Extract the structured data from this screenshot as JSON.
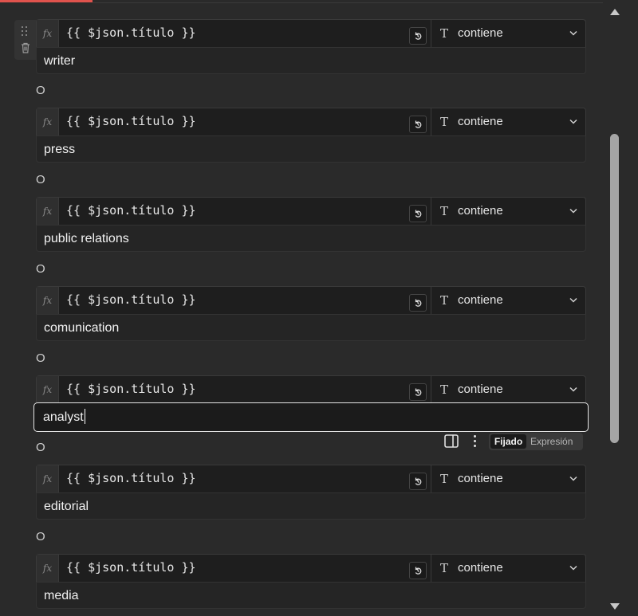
{
  "conditions": [
    {
      "expression": "{{ $json.título }}",
      "operator": "contiene",
      "value": "writer"
    },
    {
      "expression": "{{ $json.título }}",
      "operator": "contiene",
      "value": "press"
    },
    {
      "expression": "{{ $json.título }}",
      "operator": "contiene",
      "value": "public relations"
    },
    {
      "expression": "{{ $json.título }}",
      "operator": "contiene",
      "value": "comunication"
    },
    {
      "expression": "{{ $json.título }}",
      "operator": "contiene",
      "value": "analyst"
    },
    {
      "expression": "{{ $json.título }}",
      "operator": "contiene",
      "value": "editorial"
    },
    {
      "expression": "{{ $json.título }}",
      "operator": "contiene",
      "value": "media"
    }
  ],
  "combinator": "O",
  "fx_label": "fx",
  "type_icon": "T",
  "value_toolbar": {
    "mode_fixed": "Fijado",
    "mode_expression": "Expresión",
    "active_mode": "Fijado"
  },
  "icons": {
    "drag": "drag-handle-icon",
    "trash": "trash-icon",
    "reset": "reset-icon",
    "type": "text-type-icon",
    "chevron": "chevron-down-icon",
    "panel": "panel-icon",
    "more": "more-vertical-icon"
  },
  "colors": {
    "background": "#2a2a2a",
    "field": "#1e1e1e",
    "accent": "#e0534d",
    "scroll_thumb": "#a5a5a5"
  }
}
